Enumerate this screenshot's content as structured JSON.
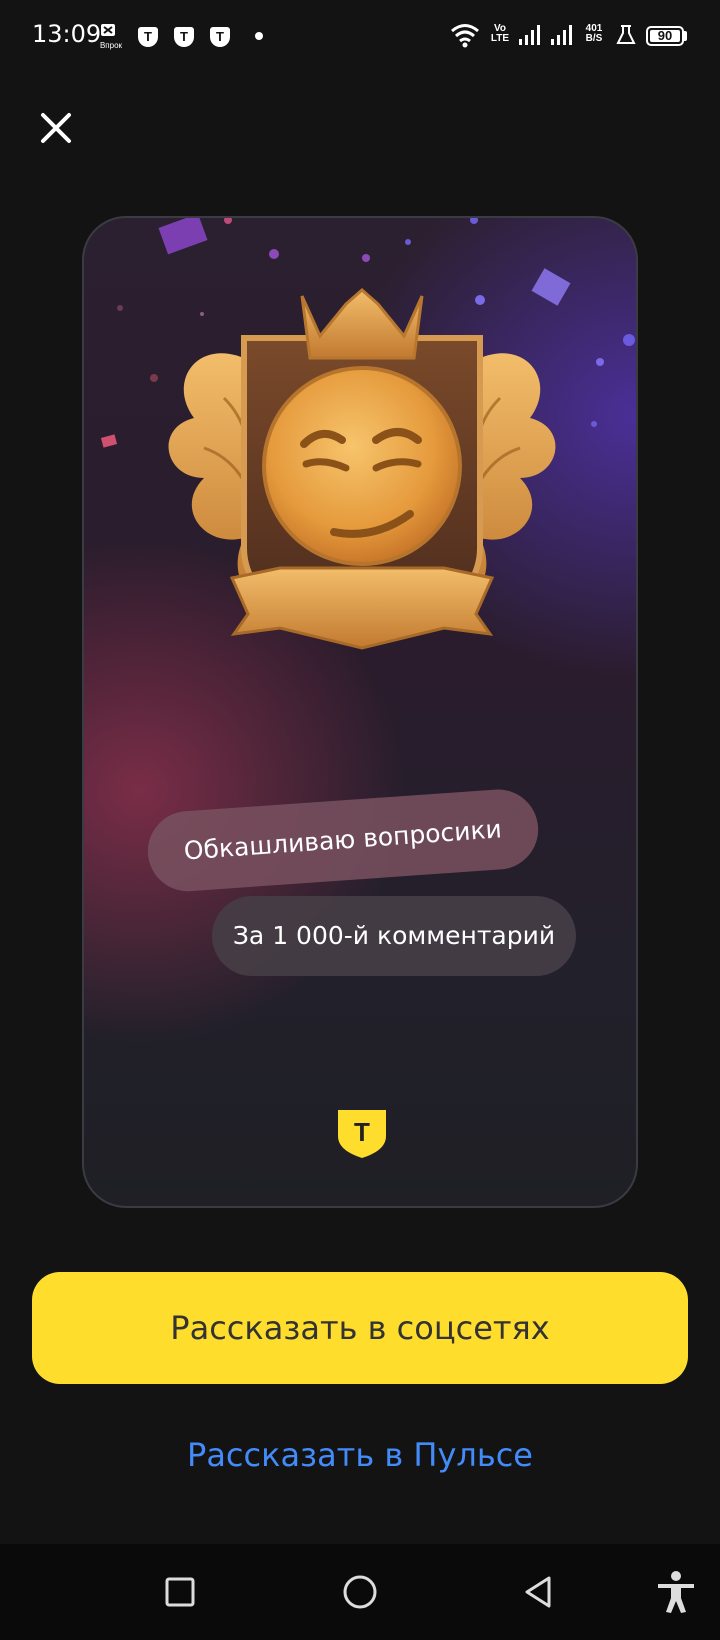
{
  "status_bar": {
    "time": "13:09",
    "vpr_label": "Впрок",
    "volte_top": "Vo",
    "volte_bottom": "LTE",
    "speed_value": "401",
    "speed_unit": "B/S",
    "battery": "90",
    "icons": [
      "vpr-app-icon",
      "t-app-icon",
      "t-app-icon",
      "t-app-icon",
      "notification-dot",
      "wifi-icon",
      "volte-icon",
      "signal-icon",
      "signal-icon",
      "network-speed",
      "lab-icon",
      "battery-icon"
    ]
  },
  "close": {
    "icon": "close-icon"
  },
  "achievement": {
    "title": "Обкашливаю вопросики",
    "subtitle": "За 1 000-й комментарий",
    "logo_letter": "Т"
  },
  "actions": {
    "share_social": "Рассказать в соцсетях",
    "share_pulse": "Рассказать в Пульсе"
  },
  "nav": [
    "recent-apps-icon",
    "home-icon",
    "back-icon",
    "accessibility-icon"
  ],
  "colors": {
    "background": "#131313",
    "accent_yellow": "#ffdd2d",
    "link_blue": "#428bf9",
    "gold": "#e0a24a"
  }
}
